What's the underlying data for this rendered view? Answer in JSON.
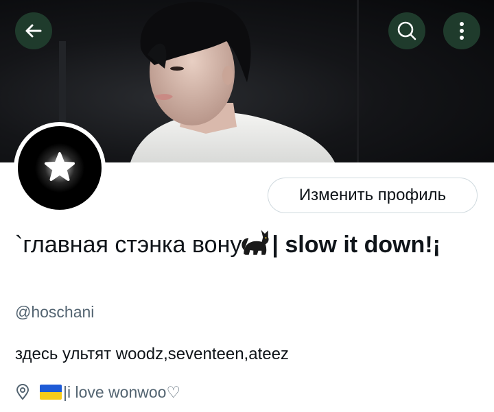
{
  "header": {
    "back_icon": "arrow-left-icon",
    "search_icon": "search-icon",
    "more_icon": "more-vertical-icon",
    "button_bg": "#1f3b2c"
  },
  "profile": {
    "edit_button_label": "Изменить профиль",
    "display_name_part1": "`главная стэнка вону",
    "display_name_part2": "| slow it down!¡",
    "handle": "@hoschani",
    "bio": "здесь ультят woodz,seventeen,ateez",
    "location": "|i love wonwoo♡",
    "location_icon": "location-pin-icon",
    "flag": "ukraine-flag-icon"
  },
  "colors": {
    "text_primary": "#0f1419",
    "text_secondary": "#536471",
    "border": "#cfd9de"
  }
}
